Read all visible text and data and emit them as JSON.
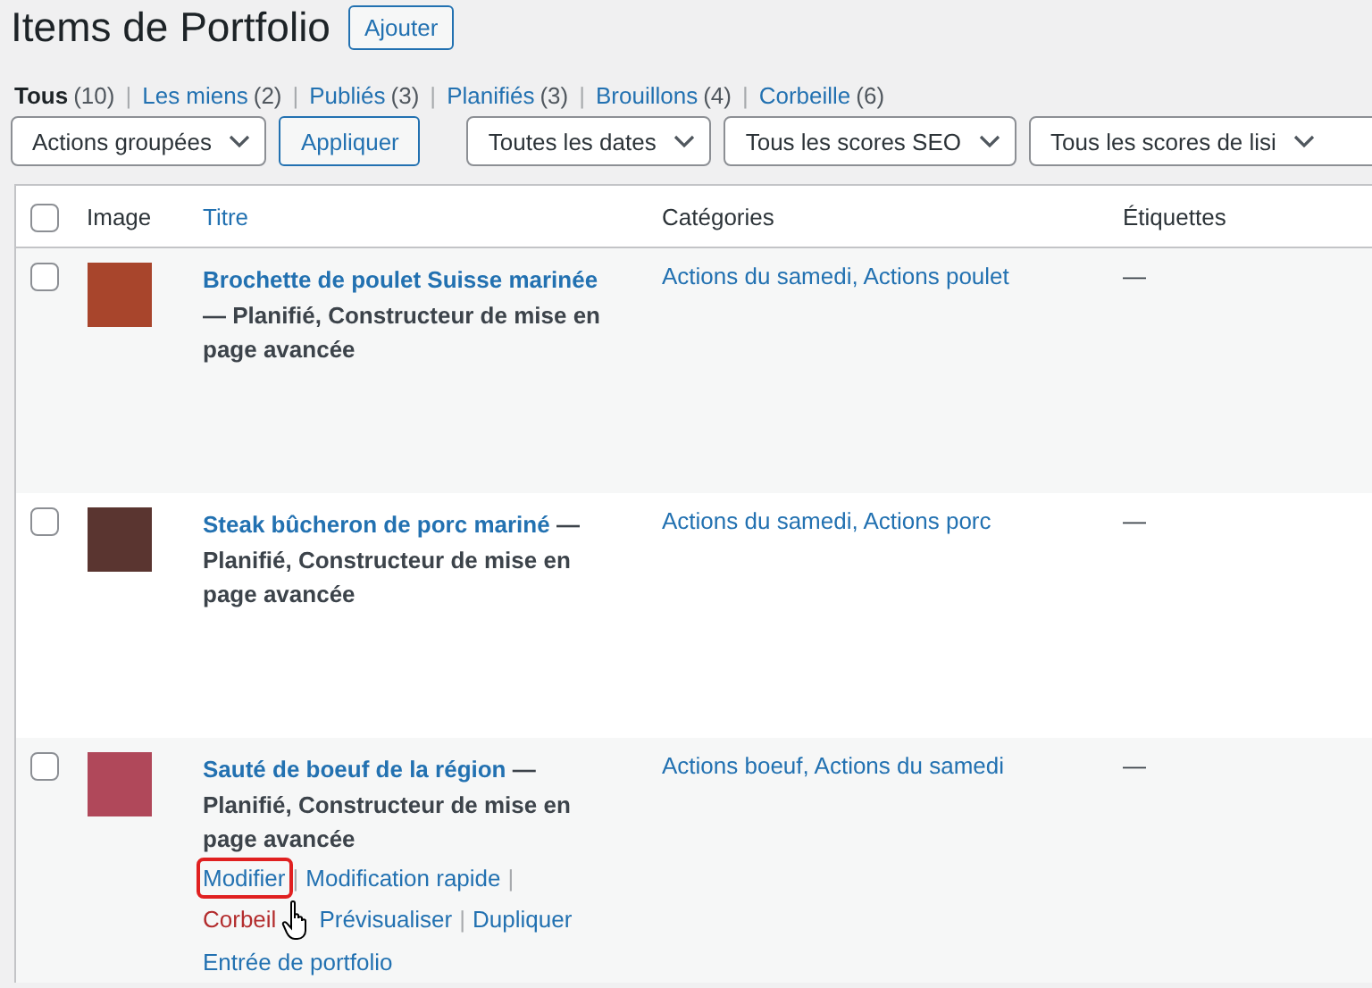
{
  "page": {
    "title": "Items de Portfolio",
    "add_button": "Ajouter"
  },
  "filters": [
    {
      "label": "Tous",
      "count": "(10)",
      "selected": true
    },
    {
      "sep": "|",
      "label": "Les miens",
      "count": "(2)",
      "selected": false
    },
    {
      "sep": "|",
      "label": "Publiés",
      "count": "(3)",
      "selected": false
    },
    {
      "sep": "|",
      "label": "Planifiés",
      "count": "(3)",
      "selected": false
    },
    {
      "sep": "|",
      "label": "Brouillons",
      "count": "(4)",
      "selected": false
    },
    {
      "sep": "|",
      "label": "Corbeille",
      "count": "(6)",
      "selected": false
    }
  ],
  "toolbar": [
    {
      "kind": "select",
      "value": "Actions groupées"
    },
    {
      "kind": "button",
      "label": "Appliquer"
    },
    {
      "kind": "select",
      "value": "Toutes les dates"
    },
    {
      "kind": "select",
      "value": "Tous les scores SEO"
    },
    {
      "kind": "select",
      "value": "Tous les scores de lisi"
    }
  ],
  "table": {
    "select_all": {
      "checked": false
    },
    "columns": [
      {
        "label": "Image",
        "kind": "plain"
      },
      {
        "label": "Titre",
        "kind": "sortable"
      },
      {
        "label": "Catégories",
        "kind": "plain"
      },
      {
        "label": "Étiquettes",
        "kind": "plain"
      }
    ],
    "rows": [
      {
        "checked": false,
        "title": "Brochette de poulet Suisse marinée",
        "state": "— Planifié, Constructeur de mise en page avancée",
        "categories": "Actions du samedi, Actions poulet",
        "tags": "—",
        "actions": []
      },
      {
        "checked": false,
        "title": "Steak bûcheron de porc mariné",
        "state": "— Planifié, Constructeur de mise en page avancée",
        "categories": "Actions du samedi, Actions porc",
        "tags": "—",
        "actions": []
      },
      {
        "checked": false,
        "title": "Sauté de boeuf de la région",
        "state": "— Planifié, Constructeur de mise en page avancée",
        "categories": "Actions boeuf, Actions du samedi",
        "tags": "—",
        "actions": [
          {
            "label": "Modifier",
            "kind": "link",
            "highlighted": true,
            "sep": "|"
          },
          {
            "label": "Modification rapide",
            "kind": "link",
            "highlighted": false,
            "sep": "|"
          },
          {
            "label": "Corbeil",
            "kind": "danger",
            "highlighted": false
          },
          {
            "label": "Prévisualiser",
            "kind": "link",
            "highlighted": false,
            "sep": "|"
          },
          {
            "label": "Dupliquer",
            "kind": "link",
            "highlighted": false
          },
          {
            "label": "Entrée de portfolio",
            "kind": "link",
            "highlighted": false
          }
        ]
      }
    ]
  }
}
